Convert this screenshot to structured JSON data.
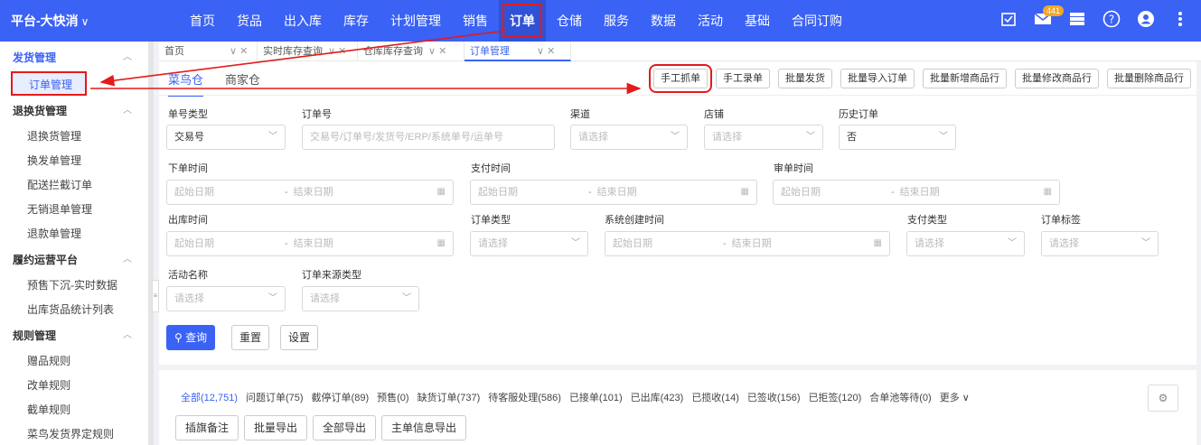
{
  "brand": {
    "title": "平台-大快消",
    "chevron": "∨"
  },
  "nav": {
    "items": [
      "首页",
      "货品",
      "出入库",
      "库存",
      "计划管理",
      "销售",
      "订单",
      "仓储",
      "服务",
      "数据",
      "活动",
      "基础",
      "合同订购"
    ],
    "active_index": 6
  },
  "top_icons": {
    "badge": "441"
  },
  "sidebar": {
    "groups": [
      {
        "label": "发货管理",
        "items": [
          "订单管理"
        ]
      },
      {
        "label": "退换货管理",
        "items": [
          "退换货管理",
          "换发单管理",
          "配送拦截订单",
          "无销退单管理",
          "退款单管理"
        ]
      },
      {
        "label": "履约运营平台",
        "items": [
          "预售下沉-实时数据",
          "出库货品统计列表"
        ]
      },
      {
        "label": "规则管理",
        "items": [
          "赠品规则",
          "改单规则",
          "截单规则",
          "菜鸟发货界定规则"
        ]
      }
    ]
  },
  "tabs": [
    {
      "label": "首页"
    },
    {
      "label": "实时库存查询"
    },
    {
      "label": "仓库库存查询"
    },
    {
      "label": "订单管理"
    }
  ],
  "warehouse_tabs": [
    "菜鸟仓",
    "商家仓"
  ],
  "actions": [
    "手工抓单",
    "手工录单",
    "批量发货",
    "批量导入订单",
    "批量新增商品行",
    "批量修改商品行",
    "批量删除商品行"
  ],
  "form": {
    "order_no_type": {
      "label": "单号类型",
      "value": "交易号"
    },
    "order_no": {
      "label": "订单号",
      "placeholder": "交易号/订单号/发货号/ERP/系统单号/运单号"
    },
    "channel": {
      "label": "渠道",
      "placeholder": "请选择"
    },
    "shop": {
      "label": "店铺",
      "placeholder": "请选择"
    },
    "history": {
      "label": "历史订单",
      "value": "否"
    },
    "order_time": {
      "label": "下单时间",
      "start": "起始日期",
      "end": "结束日期"
    },
    "pay_time": {
      "label": "支付时间",
      "start": "起始日期",
      "end": "结束日期"
    },
    "review_time": {
      "label": "审单时间",
      "start": "起始日期",
      "end": "结束日期"
    },
    "out_time": {
      "label": "出库时间",
      "start": "起始日期",
      "end": "结束日期"
    },
    "order_type": {
      "label": "订单类型",
      "placeholder": "请选择"
    },
    "create_time": {
      "label": "系统创建时间",
      "start": "起始日期",
      "end": "结束日期"
    },
    "pay_type": {
      "label": "支付类型",
      "placeholder": "请选择"
    },
    "order_tag": {
      "label": "订单标签",
      "placeholder": "请选择"
    },
    "activity": {
      "label": "活动名称",
      "placeholder": "请选择"
    },
    "source_type": {
      "label": "订单来源类型",
      "placeholder": "请选择"
    },
    "date_sep": "-",
    "search_btn": "查询",
    "reset_btn": "重置",
    "settings_btn": "设置"
  },
  "status_filters": [
    "全部(12,751)",
    "问题订单(75)",
    "截停订单(89)",
    "预售(0)",
    "缺货订单(737)",
    "待客服处理(586)",
    "已接单(101)",
    "已出库(423)",
    "已揽收(14)",
    "已签收(156)",
    "已拒签(120)",
    "合单池等待(0)",
    "更多"
  ],
  "export_buttons": [
    "插旗备注",
    "批量导出",
    "全部导出",
    "主单信息导出"
  ],
  "colors": {
    "primary": "#3a62f5",
    "highlight": "#e31b1b"
  }
}
